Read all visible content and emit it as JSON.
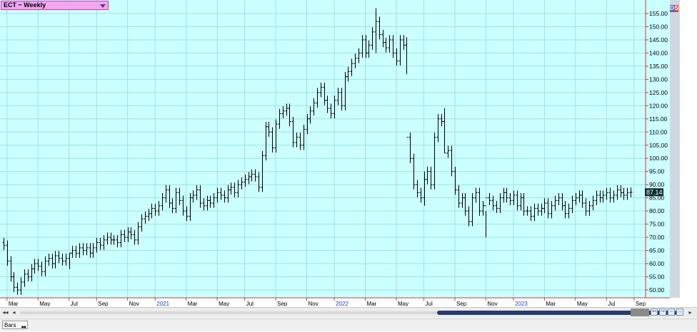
{
  "symbol_label": "ECT ~ Weekly",
  "current_price": "87.14",
  "status_tab": "Bars",
  "colors": {
    "background": "#ccffff",
    "grid": "#9fe0e6",
    "axis": "#c83c3c",
    "bars": "#000000",
    "year_label": "#1c3fcf",
    "price_flag": "#0b2e2e"
  },
  "chart_data": {
    "type": "ohlc",
    "title": "",
    "ylim": [
      47,
      160
    ],
    "y_ticks": [
      50,
      55,
      60,
      65,
      70,
      75,
      80,
      85,
      90,
      95,
      100,
      105,
      110,
      115,
      120,
      125,
      130,
      135,
      140,
      145,
      150,
      155
    ],
    "y_tick_labels": [
      "50.00",
      "55.00",
      "60.00",
      "65.00",
      "70.00",
      "75.00",
      "80.00",
      "85.00",
      "90.00",
      "95.00",
      "100.00",
      "105.00",
      "110.00",
      "115.00",
      "120.00",
      "125.00",
      "130.00",
      "135.00",
      "140.00",
      "145.00",
      "150.00",
      "155.00"
    ],
    "x_labels": [
      {
        "text": "Mar",
        "week": 1,
        "year": false
      },
      {
        "text": "May",
        "week": 10,
        "year": false
      },
      {
        "text": "Jul",
        "week": 19,
        "year": false
      },
      {
        "text": "Sep",
        "week": 27,
        "year": false
      },
      {
        "text": "Nov",
        "week": 36,
        "year": false
      },
      {
        "text": "2021",
        "week": 44,
        "year": true
      },
      {
        "text": "Mar",
        "week": 53,
        "year": false
      },
      {
        "text": "May",
        "week": 62,
        "year": false
      },
      {
        "text": "Jul",
        "week": 70,
        "year": false
      },
      {
        "text": "Sep",
        "week": 79,
        "year": false
      },
      {
        "text": "Nov",
        "week": 88,
        "year": false
      },
      {
        "text": "2022",
        "week": 96,
        "year": true
      },
      {
        "text": "Mar",
        "week": 105,
        "year": false
      },
      {
        "text": "May",
        "week": 114,
        "year": false
      },
      {
        "text": "Jul",
        "week": 122,
        "year": false
      },
      {
        "text": "Sep",
        "week": 131,
        "year": false
      },
      {
        "text": "Nov",
        "week": 140,
        "year": false
      },
      {
        "text": "2023",
        "week": 148,
        "year": true
      },
      {
        "text": "Mar",
        "week": 157,
        "year": false
      },
      {
        "text": "May",
        "week": 166,
        "year": false
      },
      {
        "text": "Jul",
        "week": 175,
        "year": false
      },
      {
        "text": "Sep",
        "week": 183,
        "year": false
      }
    ],
    "closes": [
      67,
      61,
      55,
      51,
      50,
      53,
      56,
      55,
      58,
      60,
      59,
      57,
      61,
      62,
      60,
      63,
      62,
      61,
      62,
      64,
      65,
      64,
      66,
      65,
      66,
      64,
      66,
      68,
      67,
      69,
      70,
      69,
      69,
      68,
      71,
      70,
      72,
      71,
      69,
      74,
      77,
      78,
      79,
      81,
      80,
      82,
      85,
      88,
      83,
      81,
      87,
      84,
      80,
      78,
      85,
      86,
      88,
      83,
      82,
      84,
      83,
      85,
      87,
      86,
      85,
      88,
      89,
      87,
      90,
      91,
      92,
      93,
      94,
      93,
      89,
      101,
      112,
      110,
      104,
      113,
      117,
      118,
      119,
      114,
      106,
      108,
      105,
      111,
      115,
      118,
      121,
      125,
      127,
      122,
      119,
      117,
      122,
      125,
      120,
      131,
      133,
      136,
      138,
      140,
      145,
      140,
      143,
      148,
      152,
      147,
      144,
      142,
      145,
      140,
      137,
      145,
      143,
      108,
      100,
      90,
      87,
      85,
      92,
      95,
      90,
      108,
      115,
      114,
      102,
      103,
      95,
      88,
      83,
      85,
      80,
      76,
      85,
      87,
      80,
      82,
      85,
      84,
      82,
      81,
      85,
      87,
      85,
      84,
      86,
      82,
      85,
      80,
      80,
      78,
      81,
      80,
      81,
      83,
      79,
      82,
      84,
      85,
      82,
      79,
      81,
      84,
      85,
      86,
      83,
      80,
      82,
      84,
      86,
      85,
      86,
      87,
      85,
      86,
      88,
      87,
      86,
      87,
      87.14
    ],
    "ranges": [
      {
        "week": 19,
        "high": 64,
        "low": 58
      },
      {
        "week": 108,
        "high": 157,
        "low": 140
      },
      {
        "week": 117,
        "high": 146,
        "low": 132
      },
      {
        "week": 122,
        "high": 95,
        "low": 82
      },
      {
        "week": 128,
        "high": 119,
        "low": 102
      },
      {
        "week": 140,
        "high": 80,
        "low": 70
      }
    ],
    "last_value": 87.14
  }
}
